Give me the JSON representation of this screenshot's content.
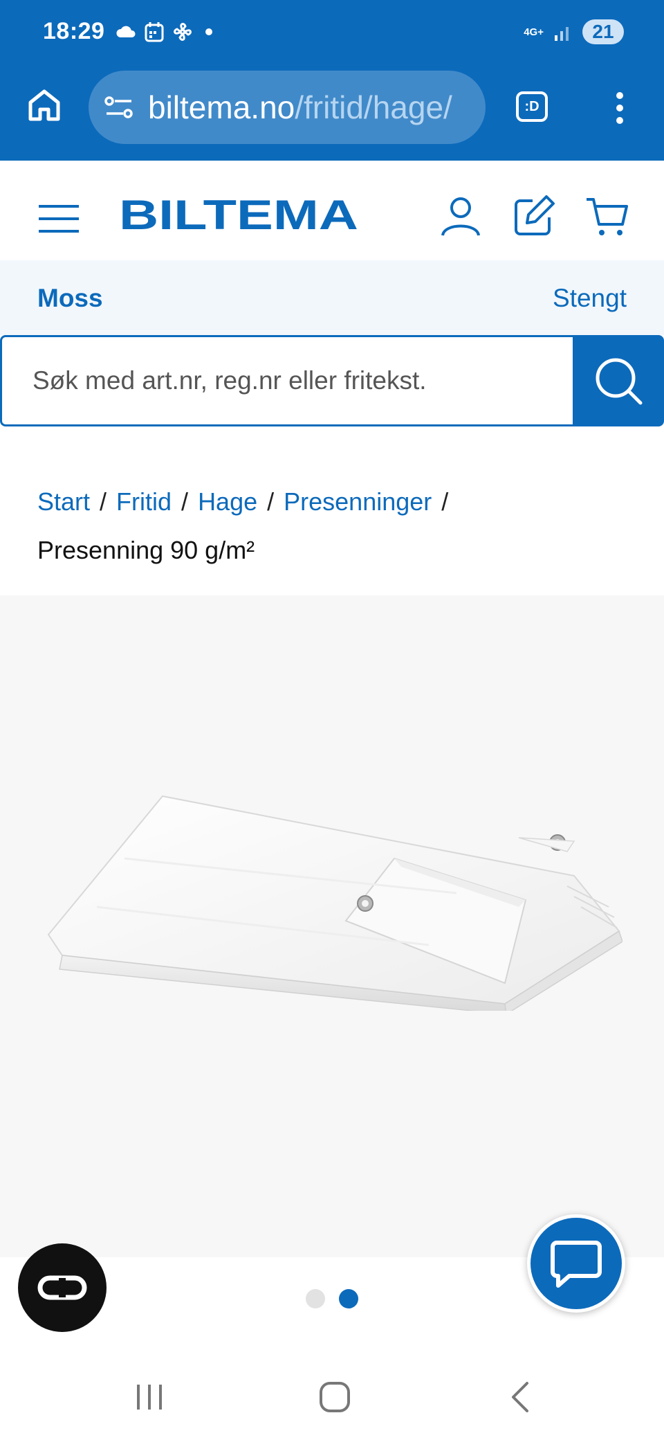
{
  "status_bar": {
    "time": "18:29",
    "network": "4G+",
    "battery": "21",
    "icons": [
      "cloud-icon",
      "calendar-icon",
      "fan-icon",
      "dot-icon",
      "signal-icon"
    ]
  },
  "browser": {
    "url_domain": "biltema.no",
    "url_path": "/fritid/hage/",
    "tab_label": ":D"
  },
  "header": {
    "logo": "BILTEMA",
    "icons": [
      "menu-icon",
      "user-icon",
      "edit-icon",
      "cart-icon"
    ]
  },
  "store": {
    "name": "Moss",
    "status": "Stengt"
  },
  "search": {
    "placeholder": "Søk med art.nr, reg.nr eller fritekst."
  },
  "breadcrumb": {
    "items": [
      "Start",
      "Fritid",
      "Hage",
      "Presenninger"
    ],
    "separator": "/",
    "current": "Presenning 90 g/m²"
  },
  "gallery": {
    "image": "white-tarpaulin",
    "page_count": 2,
    "active_page": 2
  },
  "colors": {
    "brand_blue": "#0c6abb",
    "store_bg": "#f2f7fc",
    "gallery_bg": "#f7f7f7"
  }
}
